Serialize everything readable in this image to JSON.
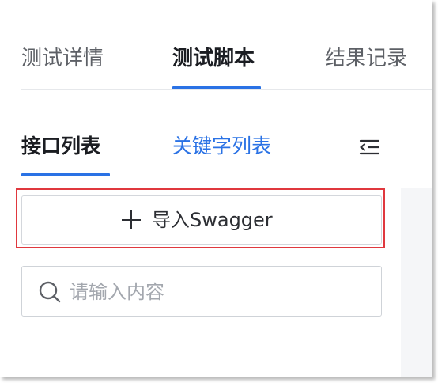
{
  "top_tabs": [
    {
      "label": "测试详情",
      "active": false
    },
    {
      "label": "测试脚本",
      "active": true
    },
    {
      "label": "结果记录",
      "active": false
    }
  ],
  "sub_tabs": [
    {
      "label": "接口列表",
      "active": true
    },
    {
      "label": "关键字列表",
      "active": false
    }
  ],
  "import_button": {
    "label": "导入Swagger",
    "icon": "plus-icon"
  },
  "search": {
    "placeholder": "请输入内容",
    "value": "",
    "icon": "search-icon"
  },
  "collapse_icon": "collapse-indent-icon",
  "colors": {
    "accent": "#2a72e5",
    "highlight_border": "#e0383e",
    "text_primary": "#1b1d22",
    "text_secondary": "#5d6066",
    "placeholder": "#a3a7ae"
  }
}
